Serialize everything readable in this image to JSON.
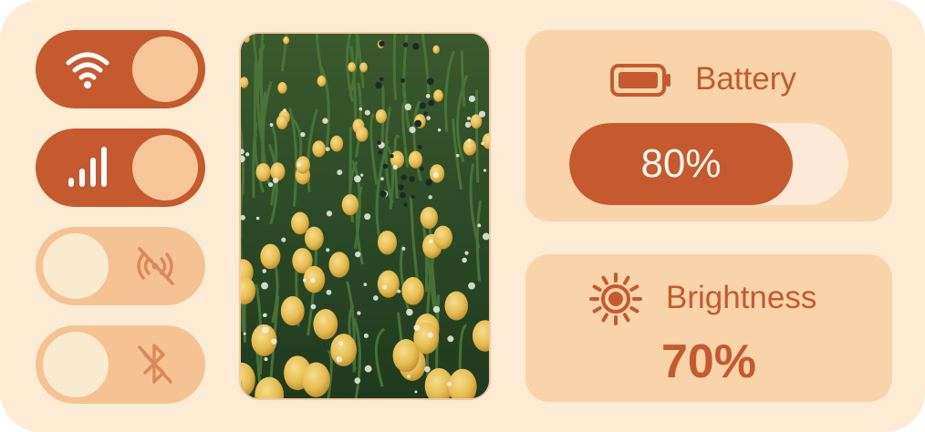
{
  "toggles": [
    {
      "id": "wifi",
      "state": "on",
      "icon": "wifi-icon"
    },
    {
      "id": "cellular",
      "state": "on",
      "icon": "signal-icon"
    },
    {
      "id": "nfc",
      "state": "off",
      "icon": "nfc-off-icon"
    },
    {
      "id": "bluetooth",
      "state": "off",
      "icon": "bluetooth-off-icon"
    }
  ],
  "photo": {
    "subject": "field of yellow tulips"
  },
  "battery": {
    "label": "Battery",
    "value_text": "80%",
    "level": 0.8,
    "icon": "battery-icon"
  },
  "brightness": {
    "label": "Brightness",
    "value_text": "70%",
    "level": 0.7,
    "icon": "sun-icon"
  },
  "colors": {
    "accent": "#c55a2f",
    "panel": "#fdebd3",
    "card": "#f9d4ab",
    "toggle_off": "#f5c293",
    "knob_on": "#f6c598",
    "knob_off": "#fbebce"
  }
}
